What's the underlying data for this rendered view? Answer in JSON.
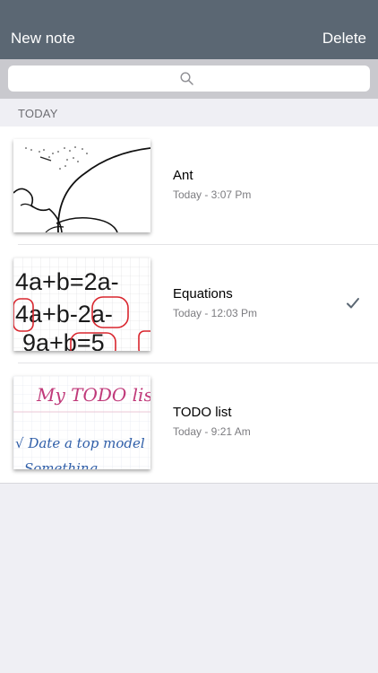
{
  "navbar": {
    "left_label": "New note",
    "right_label": "Delete"
  },
  "search": {
    "icon": "search-icon"
  },
  "section": {
    "header": "TODAY"
  },
  "notes": [
    {
      "title": "Ant",
      "date": "Today - 3:07 Pm",
      "selected": false
    },
    {
      "title": "Equations",
      "date": "Today - 12:03 Pm",
      "selected": true
    },
    {
      "title": "TODO list",
      "date": "Today - 9:21 Am",
      "selected": false
    }
  ],
  "thumbnails": {
    "equations_lines": [
      "4a+b=2a-",
      "4a+b-2a-",
      "9a+b=5"
    ],
    "todo_lines": [
      "My TODO list",
      "√ Date a top model",
      "Something"
    ]
  },
  "colors": {
    "navbar": "#5b6773",
    "background": "#efeff4",
    "check": "#5b6773",
    "ink_red": "#d9262e",
    "ink_blue": "#2f5ea8",
    "ink_pink": "#c03a7a"
  }
}
